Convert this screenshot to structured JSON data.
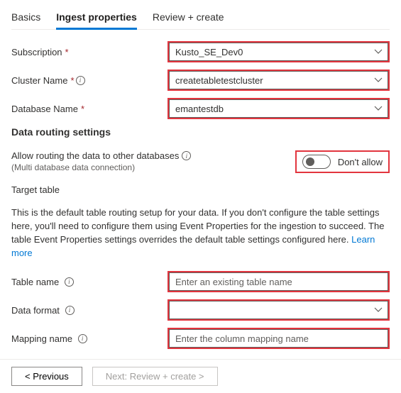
{
  "tabs": {
    "basics": "Basics",
    "ingest": "Ingest properties",
    "review": "Review + create"
  },
  "fields": {
    "subscription_label": "Subscription",
    "subscription_value": "Kusto_SE_Dev0",
    "cluster_label": "Cluster Name",
    "cluster_value": "createtabletestcluster",
    "database_label": "Database Name",
    "database_value": "emantestdb"
  },
  "routing": {
    "heading": "Data routing settings",
    "allow_label": "Allow routing the data to other databases",
    "allow_sub": "(Multi database data connection)",
    "toggle_label": "Don't allow"
  },
  "target": {
    "heading": "Target table",
    "desc_a": "This is the default table routing setup for your data. If you don't configure the table settings here, you'll need to configure them using Event Properties for the ingestion to succeed. The table Event Properties settings overrides the default table settings configured here. ",
    "learn": "Learn more",
    "table_label": "Table name",
    "table_placeholder": "Enter an existing table name",
    "format_label": "Data format",
    "format_value": "",
    "mapping_label": "Mapping name",
    "mapping_placeholder": "Enter the column mapping name"
  },
  "footer": {
    "prev": "< Previous",
    "next": "Next: Review + create >"
  },
  "colors": {
    "highlight": "#e2353e",
    "accent": "#0078d4"
  }
}
